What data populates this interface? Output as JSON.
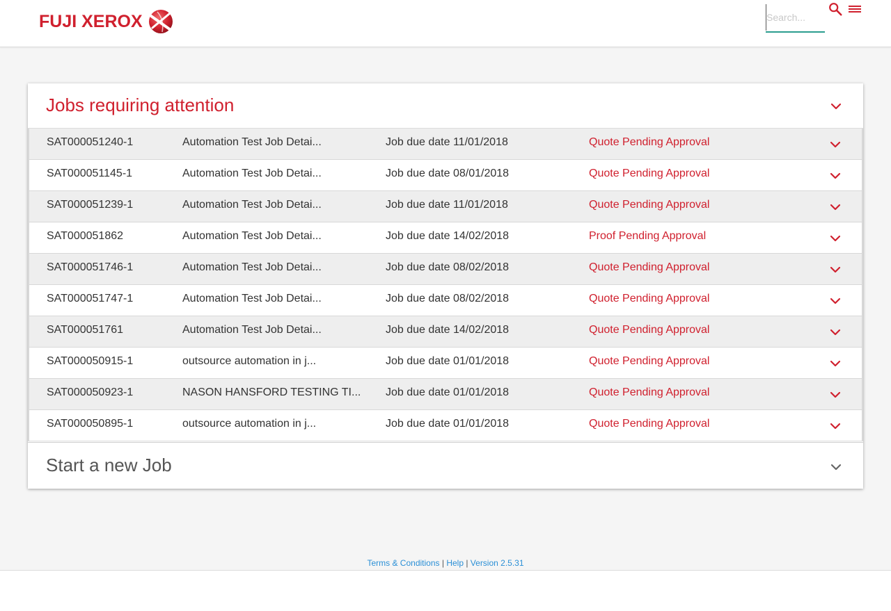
{
  "brand": {
    "name": "FUJI XEROX",
    "color": "#d0202e"
  },
  "header": {
    "search_placeholder": "Search...",
    "search_icon": "search-icon",
    "menu_icon": "hamburger-menu-icon"
  },
  "attention": {
    "title": "Jobs requiring attention",
    "jobs": [
      {
        "id": "SAT000051240-1",
        "desc": "Automation Test Job Detai...",
        "due": "Job due date 11/01/2018",
        "status": "Quote Pending Approval"
      },
      {
        "id": "SAT000051145-1",
        "desc": "Automation Test Job Detai...",
        "due": "Job due date 08/01/2018",
        "status": "Quote Pending Approval"
      },
      {
        "id": "SAT000051239-1",
        "desc": "Automation Test Job Detai...",
        "due": "Job due date 11/01/2018",
        "status": "Quote Pending Approval"
      },
      {
        "id": "SAT000051862",
        "desc": "Automation Test Job Detai...",
        "due": "Job due date 14/02/2018",
        "status": "Proof Pending Approval"
      },
      {
        "id": "SAT000051746-1",
        "desc": "Automation Test Job Detai...",
        "due": "Job due date 08/02/2018",
        "status": "Quote Pending Approval"
      },
      {
        "id": "SAT000051747-1",
        "desc": "Automation Test Job Detai...",
        "due": "Job due date 08/02/2018",
        "status": "Quote Pending Approval"
      },
      {
        "id": "SAT000051761",
        "desc": "Automation Test Job Detai...",
        "due": "Job due date 14/02/2018",
        "status": "Quote Pending Approval"
      },
      {
        "id": "SAT000050915-1",
        "desc": "outsource automation in j...",
        "due": "Job due date 01/01/2018",
        "status": "Quote Pending Approval"
      },
      {
        "id": "SAT000050923-1",
        "desc": "NASON HANSFORD TESTING TI...",
        "due": "Job due date 01/01/2018",
        "status": "Quote Pending Approval"
      },
      {
        "id": "SAT000050895-1",
        "desc": "outsource automation in j...",
        "due": "Job due date 01/01/2018",
        "status": "Quote Pending Approval"
      }
    ]
  },
  "new_job": {
    "title": "Start a new Job"
  },
  "footer": {
    "terms": "Terms & Conditions",
    "sep1": " | ",
    "help": "Help",
    "sep2": " | ",
    "version": "Version 2.5.31"
  },
  "colors": {
    "accent": "#d0202e",
    "link": "#2a8fd6",
    "underline": "#2a9d8f"
  }
}
